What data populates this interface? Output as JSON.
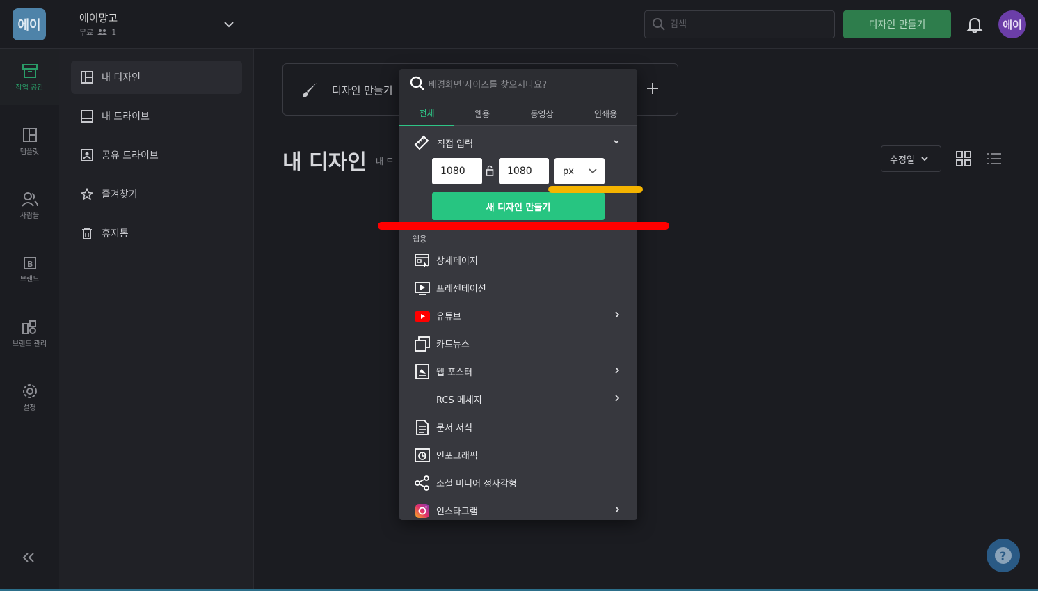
{
  "topbar": {
    "logo_text": "에이",
    "workspace_name": "에이망고",
    "plan": "무료",
    "member_count": "1",
    "search_placeholder": "검색",
    "create_button": "디자인 만들기",
    "avatar_text": "에이"
  },
  "rail": {
    "items": [
      {
        "label": "작업 공간",
        "icon": "archive-icon"
      },
      {
        "label": "템플릿",
        "icon": "layout-icon"
      },
      {
        "label": "사람들",
        "icon": "people-icon"
      },
      {
        "label": "브랜드",
        "icon": "brand-icon"
      },
      {
        "label": "브랜드 관리",
        "icon": "brand-manage-icon"
      },
      {
        "label": "설정",
        "icon": "gear-icon"
      }
    ]
  },
  "sidebar": {
    "items": [
      {
        "label": "내 디자인",
        "icon": "grid-icon"
      },
      {
        "label": "내 드라이브",
        "icon": "drive-icon"
      },
      {
        "label": "공유 드라이브",
        "icon": "shared-drive-icon"
      },
      {
        "label": "즐겨찾기",
        "icon": "star-icon"
      },
      {
        "label": "휴지통",
        "icon": "trash-icon"
      }
    ]
  },
  "main": {
    "create_card_label": "디자인 만들기",
    "page_title": "내 디자인",
    "page_sub": "내 드",
    "sort_label": "수정일"
  },
  "dropdown": {
    "search_placeholder": "배경화면'사이즈를 찾으시나요?",
    "tabs": [
      "전체",
      "웹용",
      "동영상",
      "인쇄용"
    ],
    "active_tab": "전체",
    "direct_input_label": "직접 입력",
    "width_value": "1080",
    "height_value": "1080",
    "unit_value": "px",
    "new_design_button": "새 디자인 만들기",
    "section_label": "웹용",
    "items": [
      {
        "label": "상세페이지",
        "icon": "detail-page-icon",
        "has_arrow": false
      },
      {
        "label": "프레젠테이션",
        "icon": "presentation-icon",
        "has_arrow": false
      },
      {
        "label": "유튜브",
        "icon": "youtube-icon",
        "has_arrow": true
      },
      {
        "label": "카드뉴스",
        "icon": "card-news-icon",
        "has_arrow": false
      },
      {
        "label": "웹 포스터",
        "icon": "web-poster-icon",
        "has_arrow": true
      },
      {
        "label": "RCS 메세지",
        "icon": "",
        "has_arrow": true
      },
      {
        "label": "문서 서식",
        "icon": "document-icon",
        "has_arrow": false
      },
      {
        "label": "인포그래픽",
        "icon": "infographic-icon",
        "has_arrow": false
      },
      {
        "label": "소셜 미디어 정사각형",
        "icon": "share-icon",
        "has_arrow": false
      },
      {
        "label": "인스타그램",
        "icon": "instagram-icon",
        "has_arrow": true
      }
    ]
  },
  "colors": {
    "accent_green": "#27c581",
    "annotation_yellow": "#f5b400",
    "annotation_red": "#ff0000"
  }
}
